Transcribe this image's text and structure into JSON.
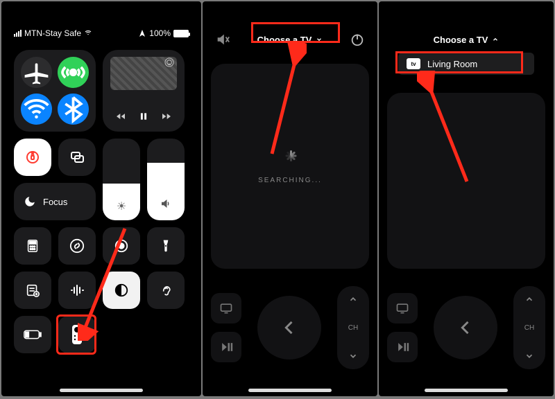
{
  "panel1": {
    "status": {
      "carrier": "MTN-Stay Safe",
      "battery_pct": "100%"
    },
    "focus_label": "Focus"
  },
  "panel2": {
    "choose_label": "Choose a TV",
    "searching_label": "SEARCHING..."
  },
  "panel3": {
    "choose_label": "Choose a TV",
    "dropdown": {
      "item1_label": "Living Room"
    }
  },
  "remote": {
    "ch_label": "CH"
  },
  "icons": {
    "atv_badge": "tv"
  }
}
